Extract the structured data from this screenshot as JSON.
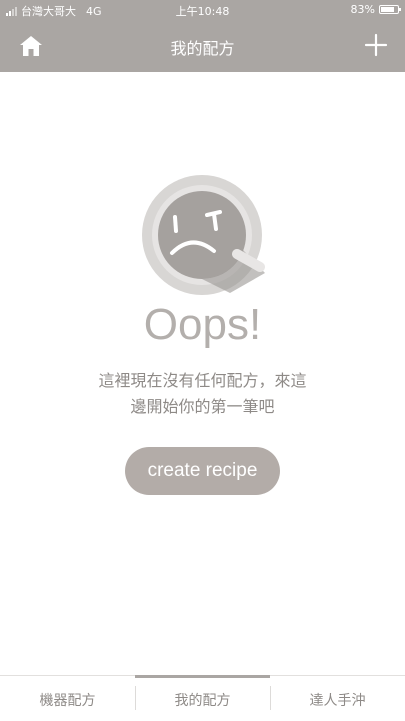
{
  "status_bar": {
    "carrier": "台灣大哥大",
    "network": "4G",
    "time": "上午10:48",
    "battery": "83%",
    "battery_level": 0.83
  },
  "header": {
    "title": "我的配方",
    "left_icon": "home-icon",
    "right_icon": "plus-icon"
  },
  "empty_state": {
    "illustration": "sad-magnifier-icon",
    "heading": "Oops!",
    "message_line1": "這裡現在沒有任何配方，來這",
    "message_line2": "邊開始你的第一筆吧",
    "button_label": "create recipe"
  },
  "tabs": [
    {
      "label": "機器配方",
      "active": false
    },
    {
      "label": "我的配方",
      "active": true
    },
    {
      "label": "達人手沖",
      "active": false
    }
  ],
  "colors": {
    "header_bg": "#aaa6a3",
    "button_bg": "#b3aca8",
    "text": "#8e8a87"
  }
}
